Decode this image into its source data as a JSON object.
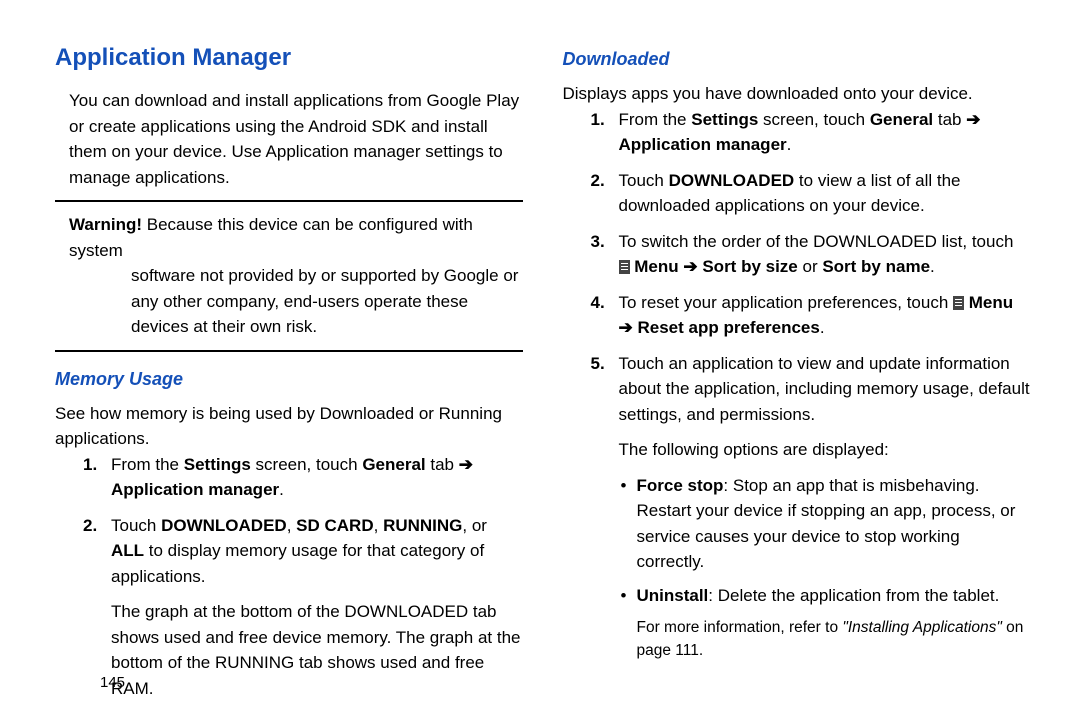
{
  "left": {
    "heading": "Application Manager",
    "intro": "You can download and install applications from Google Play or create applications using the Android SDK and install them on your device. Use Application manager settings to manage applications.",
    "warning_label": "Warning!",
    "warning_body": "Because this device can be configured with system software not provided by or supported by Google or any other company, end-users operate these devices at their own risk.",
    "memory_heading": "Memory Usage",
    "memory_intro": "See how memory is being used by Downloaded or Running applications.",
    "step1_a": "From the ",
    "step1_b": "Settings",
    "step1_c": " screen, touch ",
    "step1_d": "General",
    "step1_e": " tab ",
    "step1_f": "Application manager",
    "step2_a": "Touch ",
    "step2_b": "DOWNLOADED",
    "step2_c": ", ",
    "step2_d": "SD CARD",
    "step2_e": ", ",
    "step2_f": "RUNNING",
    "step2_g": ", or ",
    "step2_h": "ALL",
    "step2_i": " to display memory usage for that category of applications.",
    "graph_note": "The graph at the bottom of the DOWNLOADED tab shows used and free device memory. The graph at the bottom of the RUNNING tab shows used and free RAM."
  },
  "right": {
    "heading": "Downloaded",
    "intro": "Displays apps you have downloaded onto your device.",
    "s1_a": "From the ",
    "s1_b": "Settings",
    "s1_c": " screen, touch ",
    "s1_d": "General",
    "s1_e": " tab ",
    "s1_f": "Application manager",
    "s2_a": "Touch ",
    "s2_b": "DOWNLOADED",
    "s2_c": " to view a list of all the downloaded applications on your device.",
    "s3_a": "To switch the order of the DOWNLOADED list, touch ",
    "s3_menu": "Menu",
    "s3_b": "Sort by size",
    "s3_c": " or ",
    "s3_d": "Sort by name",
    "s4_a": "To reset your application preferences, touch ",
    "s4_menu": "Menu",
    "s4_b": "Reset app preferences",
    "s5": "Touch an application to view and update information about the application, including memory usage, default settings, and permissions.",
    "options_intro": "The following options are displayed:",
    "opt1_label": "Force stop",
    "opt1_body": ": Stop an app that is misbehaving. Restart your device if stopping an app, process, or service causes your device to stop working correctly.",
    "opt2_label": "Uninstall",
    "opt2_body": ": Delete the application from the tablet.",
    "ref_a": "For more information, refer to ",
    "ref_b": "\"Installing Applications\"",
    "ref_c": " on page 111."
  },
  "arrow": "➔",
  "page_number": "145"
}
